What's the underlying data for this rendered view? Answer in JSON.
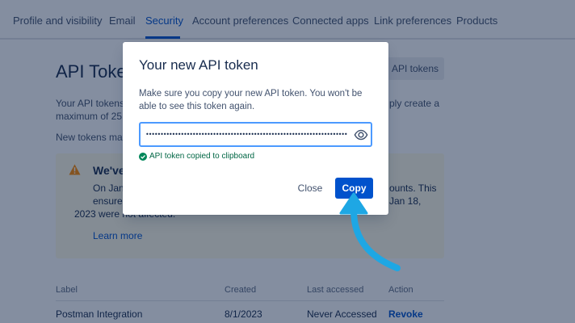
{
  "nav": {
    "items": [
      {
        "label": "Profile and visibility"
      },
      {
        "label": "Email"
      },
      {
        "label": "Security"
      },
      {
        "label": "Account preferences"
      },
      {
        "label": "Connected apps"
      },
      {
        "label": "Link preferences"
      },
      {
        "label": "Products"
      }
    ],
    "active_index": 2
  },
  "page": {
    "title": "API Token",
    "manage_button": "API tokens",
    "desc_line1": "Your API tokens",
    "desc_line1b": "ply create a",
    "desc_line2": "maximum of 25",
    "desc_line3": "New tokens may",
    "warning": {
      "title": "We've",
      "text1": "On Jan",
      "text1b": "ounts. This",
      "text2": "ensures",
      "text2b": "Jan 18,",
      "text3": "2023 were not affected.",
      "link": "Learn more"
    },
    "table": {
      "headers": [
        "Label",
        "Created",
        "Last accessed",
        "Action"
      ],
      "rows": [
        {
          "label": "Postman Integration",
          "created": "8/1/2023",
          "last_accessed": "Never Accessed",
          "action": "Revoke"
        }
      ]
    }
  },
  "modal": {
    "title": "Your new API token",
    "desc_line1": "Make sure you copy your new API token. You won't be",
    "desc_line2": "able to see this token again.",
    "token_masked": "•••••••••••••••••••••••••••••••••••••••••••••••••••••••••••••••••••••••••••••••••••",
    "copied_message": "API token copied to clipboard",
    "close_label": "Close",
    "copy_label": "Copy"
  },
  "colors": {
    "primary": "#0052cc",
    "success": "#006644",
    "focus": "#4c9aff",
    "overlay": "rgba(9, 30, 66, 0.50)",
    "callout_arrow": "#1ea7e4"
  },
  "icons": {
    "warning": "warning-icon",
    "eye": "eye-icon",
    "success": "check-circle-icon",
    "arrow": "curved-arrow-icon"
  }
}
